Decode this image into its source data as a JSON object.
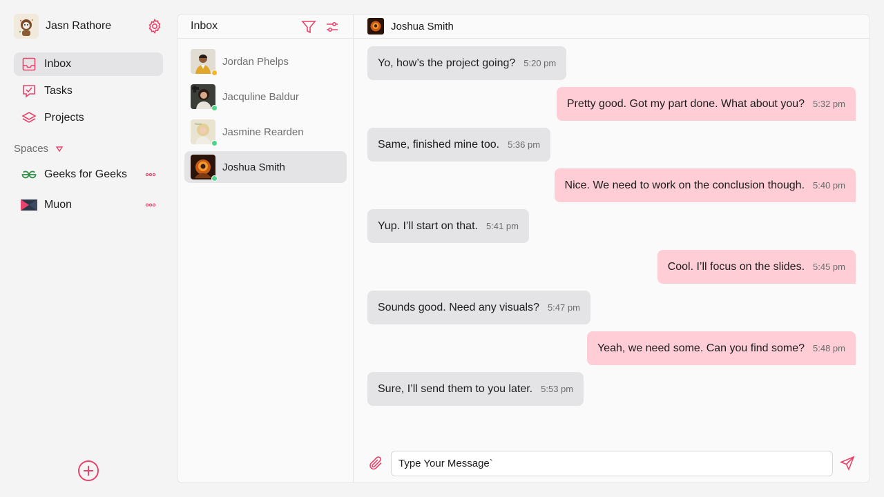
{
  "user": {
    "name": "Jasn Rathore"
  },
  "nav": [
    {
      "label": "Inbox",
      "active": true
    },
    {
      "label": "Tasks"
    },
    {
      "label": "Projects"
    }
  ],
  "spaces": {
    "label": "Spaces",
    "items": [
      {
        "label": "Geeks  for Geeks"
      },
      {
        "label": "Muon"
      }
    ]
  },
  "inbox": {
    "title": "Inbox",
    "contacts": [
      {
        "name": "Jordan Phelps",
        "status": "away",
        "status_color": "#f5b62a"
      },
      {
        "name": "Jacquline Baldur",
        "status": "online",
        "status_color": "#4fd68d"
      },
      {
        "name": "Jasmine Rearden",
        "status": "online",
        "status_color": "#4fd68d"
      },
      {
        "name": "Joshua Smith",
        "status": "online",
        "status_color": "#4fd68d",
        "active": true
      }
    ]
  },
  "chat": {
    "contact_name": "Joshua Smith",
    "messages": [
      {
        "dir": "in",
        "text": "Yo, how’s the project going?",
        "time": "5:20 pm"
      },
      {
        "dir": "out",
        "text": "Pretty good. Got my part done. What about you?",
        "time": "5:32 pm"
      },
      {
        "dir": "in",
        "text": "Same, finished mine too.",
        "time": "5:36 pm"
      },
      {
        "dir": "out",
        "text": "Nice. We need to work on the conclusion though.",
        "time": "5:40 pm"
      },
      {
        "dir": "in",
        "text": "Yup. I’ll start on that.",
        "time": "5:41 pm"
      },
      {
        "dir": "out",
        "text": "Cool. I’ll focus on the slides.",
        "time": "5:45 pm"
      },
      {
        "dir": "in",
        "text": " Sounds good. Need any visuals?",
        "time": "5:47 pm"
      },
      {
        "dir": "out",
        "text": "Yeah, we need some. Can you find some?",
        "time": "5:48 pm"
      },
      {
        "dir": "in",
        "text": "Sure, I’ll send them to you later.",
        "time": "5:53 pm"
      }
    ],
    "composer": {
      "value": "Type Your Message`"
    }
  },
  "colors": {
    "accent": "#e8436a",
    "outgoing": "#fecdd6",
    "incoming": "#e4e4e7",
    "online": "#4fd68d",
    "away": "#f5b62a",
    "gfg_green": "#2f8d46"
  },
  "icons": {
    "settings": "gear-icon",
    "inbox": "inbox-icon",
    "tasks": "tasks-icon",
    "projects": "layers-icon",
    "spaces_toggle": "chevron-down-icon",
    "more": "more-dots-icon",
    "add": "plus-circle-icon",
    "filter": "filter-icon",
    "adjust": "sliders-icon",
    "attach": "paperclip-icon",
    "send": "send-icon"
  }
}
